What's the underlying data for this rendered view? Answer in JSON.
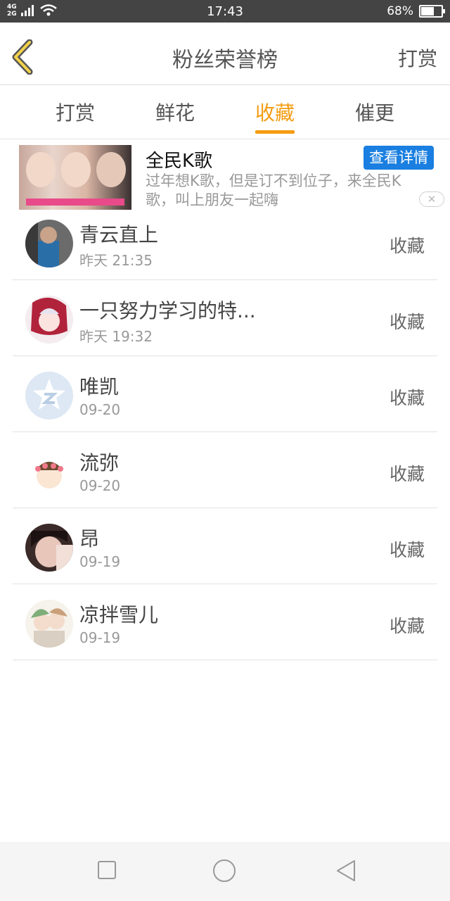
{
  "status_bar": {
    "network_top": "4G",
    "network_bottom": "2G",
    "time": "17:43",
    "battery": "68%",
    "battery_level": 0.68
  },
  "header": {
    "title": "粉丝荣誉榜",
    "right_action": "打赏",
    "back_icon": "chevron-left-icon",
    "accent": "#f39c12"
  },
  "tabs": [
    {
      "label": "打赏",
      "active": false
    },
    {
      "label": "鲜花",
      "active": false
    },
    {
      "label": "收藏",
      "active": true
    },
    {
      "label": "催更",
      "active": false
    }
  ],
  "ad": {
    "title": "全民K歌",
    "button_label": "查看详情",
    "description": "过年想K歌，但是订不到位子，来全民K歌，叫上朋友一起嗨",
    "close_icon": "close-icon"
  },
  "list": [
    {
      "name": "青云直上",
      "time": "昨天 21:35",
      "action": "收藏"
    },
    {
      "name": "一只努力学习的特...",
      "time": "昨天 19:32",
      "action": "收藏"
    },
    {
      "name": "唯凯",
      "time": "09-20",
      "action": "收藏"
    },
    {
      "name": "流弥",
      "time": "09-20",
      "action": "收藏"
    },
    {
      "name": "昂",
      "time": "09-19",
      "action": "收藏"
    },
    {
      "name": "凉拌雪儿",
      "time": "09-19",
      "action": "收藏"
    }
  ],
  "bottom_nav": {
    "recent_icon": "square-icon",
    "home_icon": "circle-icon",
    "back_icon": "triangle-back-icon"
  }
}
